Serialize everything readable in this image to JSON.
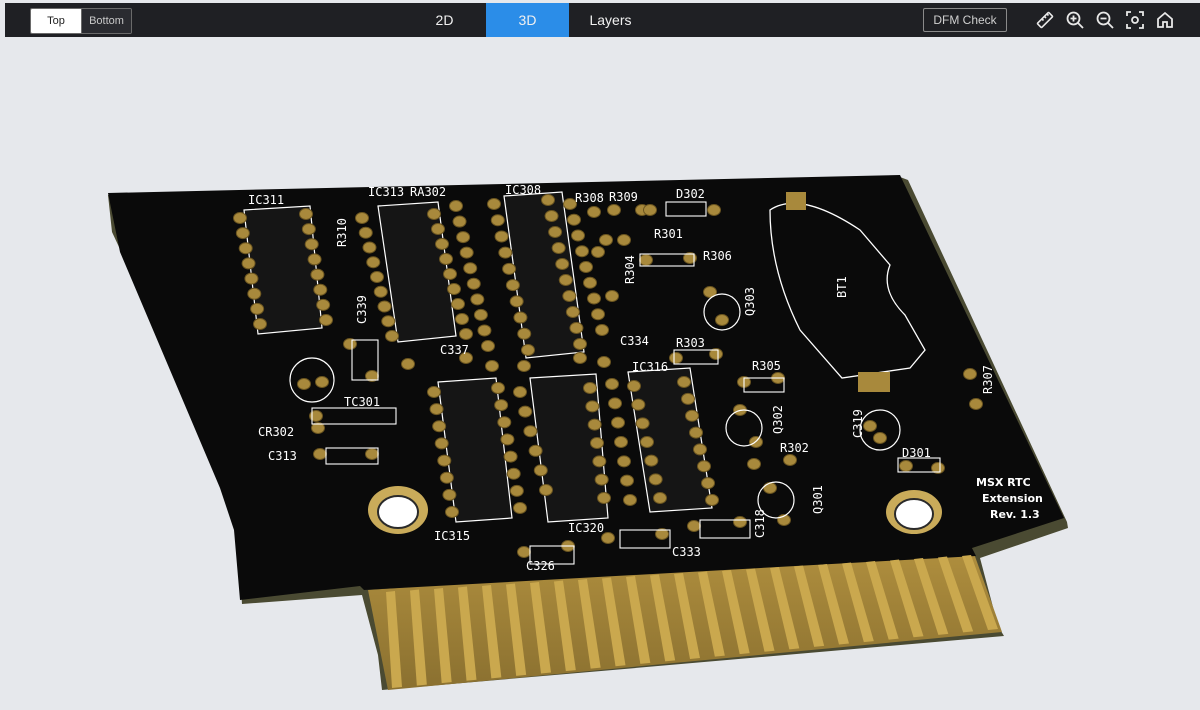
{
  "toolbar": {
    "side_top": "Top",
    "side_bottom": "Bottom",
    "tabs": [
      {
        "label": "2D"
      },
      {
        "label": "3D"
      },
      {
        "label": "Layers"
      }
    ],
    "active_tab": "3D",
    "dfm_check": "DFM Check",
    "icons": [
      "ruler-icon",
      "zoom-in-icon",
      "zoom-out-icon",
      "fit-view-icon",
      "home-icon"
    ]
  },
  "board": {
    "designators": {
      "ic311": "IC311",
      "ic313": "IC313",
      "ra302": "RA302",
      "ic308": "IC308",
      "r308": "R308",
      "r309": "R309",
      "d302": "D302",
      "r310": "R310",
      "r301": "R301",
      "r306": "R306",
      "r304": "R304",
      "q303": "Q303",
      "bt1": "BT1",
      "c339": "C339",
      "c337": "C337",
      "c334": "C334",
      "r303": "R303",
      "ic316": "IC316",
      "r305": "R305",
      "r307": "R307",
      "tc301": "TC301",
      "cr302": "CR302",
      "c313": "C313",
      "q302": "Q302",
      "c319": "C319",
      "r302": "R302",
      "d301": "D301",
      "q301": "Q301",
      "c318": "C318",
      "ic315": "IC315",
      "ic320": "IC320",
      "c333": "C333",
      "c326": "C326"
    },
    "title_lines": [
      "MSX RTC",
      "Extension",
      "Rev. 1.3"
    ]
  },
  "colors": {
    "toolbar_bg": "#1f2024",
    "accent": "#2b8de8",
    "board_black": "#0a0a0a",
    "pad_gold": "#a8893c",
    "background": "#e6e8ec"
  }
}
